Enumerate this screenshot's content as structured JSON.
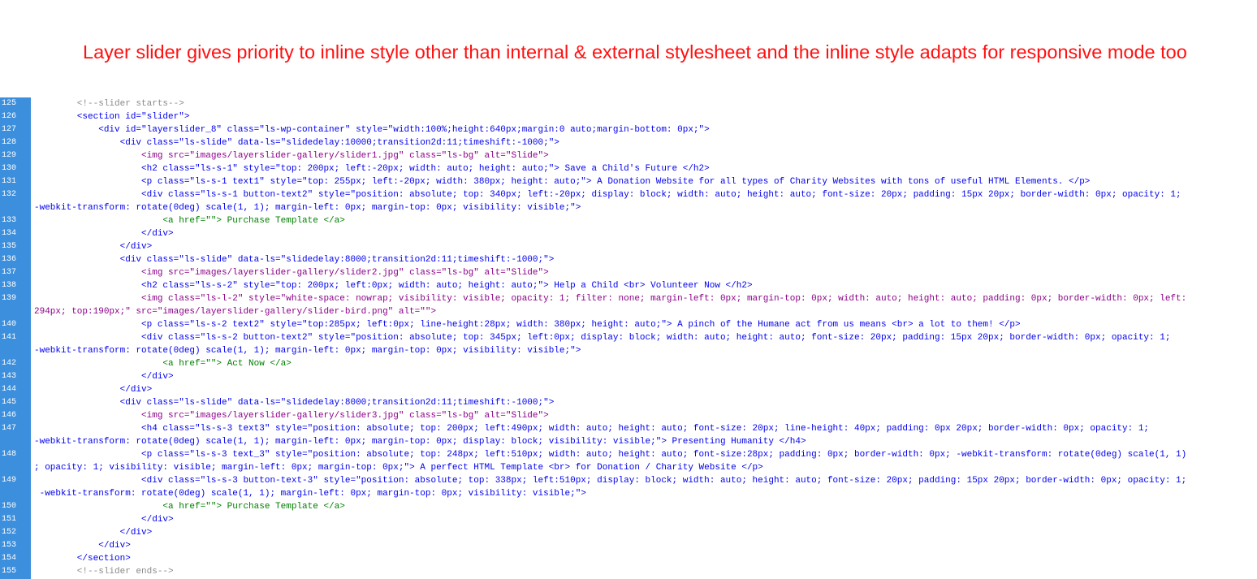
{
  "banner": {
    "text": "Layer slider gives priority to inline style other than internal & external stylesheet and the inline style adapts for responsive mode too"
  },
  "colors": {
    "heading": "#ff1111",
    "gutter": "#3c8fdc",
    "tag": "#0000ee",
    "img_tag": "#8b0088",
    "anchor_tag": "#008000",
    "comment": "#8a8a8a"
  },
  "editor": {
    "lines": [
      {
        "num": "125",
        "kind": "comment",
        "code": "        <!--slider starts-->"
      },
      {
        "num": "126",
        "kind": "tag",
        "code": "        <section id=\"slider\">"
      },
      {
        "num": "127",
        "kind": "tag",
        "code": "            <div id=\"layerslider_8\" class=\"ls-wp-container\" style=\"width:100%;height:640px;margin:0 auto;margin-bottom: 0px;\">"
      },
      {
        "num": "128",
        "kind": "tag",
        "code": "                <div class=\"ls-slide\" data-ls=\"slidedelay:10000;transition2d:11;timeshift:-1000;\">"
      },
      {
        "num": "129",
        "kind": "img",
        "code": "                    <img src=\"images/layerslider-gallery/slider1.jpg\" class=\"ls-bg\" alt=\"Slide\">"
      },
      {
        "num": "130",
        "kind": "tag",
        "code": "                    <h2 class=\"ls-s-1\" style=\"top: 200px; left:-20px; width: auto; height: auto;\"> Save a Child's Future </h2>"
      },
      {
        "num": "131",
        "kind": "tag",
        "code": "                    <p class=\"ls-s-1 text1\" style=\"top: 255px; left:-20px; width: 380px; height: auto;\"> A Donation Website for all types of Charity Websites with tons of useful HTML Elements. </p>"
      },
      {
        "num": "132",
        "kind": "tag",
        "code": "                    <div class=\"ls-s-1 button-text2\" style=\"position: absolute; top: 340px; left:-20px; display: block; width: auto; height: auto; font-size: 20px; padding: 15px 20px; border-width: 0px; opacity: 1;"
      },
      {
        "num": "",
        "kind": "tag",
        "code": "-webkit-transform: rotate(0deg) scale(1, 1); margin-left: 0px; margin-top: 0px; visibility: visible;\">"
      },
      {
        "num": "133",
        "kind": "a",
        "code": "                        <a href=\"\"> Purchase Template </a>"
      },
      {
        "num": "134",
        "kind": "tag",
        "code": "                    </div>"
      },
      {
        "num": "135",
        "kind": "tag",
        "code": "                </div>"
      },
      {
        "num": "136",
        "kind": "tag",
        "code": "                <div class=\"ls-slide\" data-ls=\"slidedelay:8000;transition2d:11;timeshift:-1000;\">"
      },
      {
        "num": "137",
        "kind": "img",
        "code": "                    <img src=\"images/layerslider-gallery/slider2.jpg\" class=\"ls-bg\" alt=\"Slide\">"
      },
      {
        "num": "138",
        "kind": "tag",
        "code": "                    <h2 class=\"ls-s-2\" style=\"top: 200px; left:0px; width: auto; height: auto;\"> Help a Child <br> Volunteer Now </h2>"
      },
      {
        "num": "139",
        "kind": "img",
        "code": "                    <img class=\"ls-l-2\" style=\"white-space: nowrap; visibility: visible; opacity: 1; filter: none; margin-left: 0px; margin-top: 0px; width: auto; height: auto; padding: 0px; border-width: 0px; left:"
      },
      {
        "num": "",
        "kind": "img",
        "code": "294px; top:190px;\" src=\"images/layerslider-gallery/slider-bird.png\" alt=\"\">"
      },
      {
        "num": "140",
        "kind": "tag",
        "code": "                    <p class=\"ls-s-2 text2\" style=\"top:285px; left:0px; line-height:28px; width: 380px; height: auto;\"> A pinch of the Humane act from us means <br> a lot to them! </p>"
      },
      {
        "num": "141",
        "kind": "tag",
        "code": "                    <div class=\"ls-s-2 button-text2\" style=\"position: absolute; top: 345px; left:0px; display: block; width: auto; height: auto; font-size: 20px; padding: 15px 20px; border-width: 0px; opacity: 1;"
      },
      {
        "num": "",
        "kind": "tag",
        "code": "-webkit-transform: rotate(0deg) scale(1, 1); margin-left: 0px; margin-top: 0px; visibility: visible;\">"
      },
      {
        "num": "142",
        "kind": "a",
        "code": "                        <a href=\"\"> Act Now </a>"
      },
      {
        "num": "143",
        "kind": "tag",
        "code": "                    </div>"
      },
      {
        "num": "144",
        "kind": "tag",
        "code": "                </div>"
      },
      {
        "num": "145",
        "kind": "tag",
        "code": "                <div class=\"ls-slide\" data-ls=\"slidedelay:8000;transition2d:11;timeshift:-1000;\">"
      },
      {
        "num": "146",
        "kind": "img",
        "code": "                    <img src=\"images/layerslider-gallery/slider3.jpg\" class=\"ls-bg\" alt=\"Slide\">"
      },
      {
        "num": "147",
        "kind": "tag",
        "code": "                    <h4 class=\"ls-s-3 text3\" style=\"position: absolute; top: 200px; left:490px; width: auto; height: auto; font-size: 20px; line-height: 40px; padding: 0px 20px; border-width: 0px; opacity: 1;"
      },
      {
        "num": "",
        "kind": "tag",
        "code": "-webkit-transform: rotate(0deg) scale(1, 1); margin-left: 0px; margin-top: 0px; display: block; visibility: visible;\"> Presenting Humanity </h4>"
      },
      {
        "num": "148",
        "kind": "tag",
        "code": "                    <p class=\"ls-s-3 text_3\" style=\"position: absolute; top: 248px; left:510px; width: auto; height: auto; font-size:28px; padding: 0px; border-width: 0px; -webkit-transform: rotate(0deg) scale(1, 1)"
      },
      {
        "num": "",
        "kind": "tag",
        "code": "; opacity: 1; visibility: visible; margin-left: 0px; margin-top: 0px;\"> A perfect HTML Template <br> for Donation / Charity Website </p>"
      },
      {
        "num": "149",
        "kind": "tag",
        "code": "                    <div class=\"ls-s-3 button-text-3\" style=\"position: absolute; top: 338px; left:510px; display: block; width: auto; height: auto; font-size: 20px; padding: 15px 20px; border-width: 0px; opacity: 1;"
      },
      {
        "num": "",
        "kind": "tag",
        "code": " -webkit-transform: rotate(0deg) scale(1, 1); margin-left: 0px; margin-top: 0px; visibility: visible;\">"
      },
      {
        "num": "150",
        "kind": "a",
        "code": "                        <a href=\"\"> Purchase Template </a>"
      },
      {
        "num": "151",
        "kind": "tag",
        "code": "                    </div>"
      },
      {
        "num": "152",
        "kind": "tag",
        "code": "                </div>"
      },
      {
        "num": "153",
        "kind": "tag",
        "code": "            </div>"
      },
      {
        "num": "154",
        "kind": "tag",
        "code": "        </section>"
      },
      {
        "num": "155",
        "kind": "comment",
        "code": "        <!--slider ends-->"
      }
    ]
  }
}
